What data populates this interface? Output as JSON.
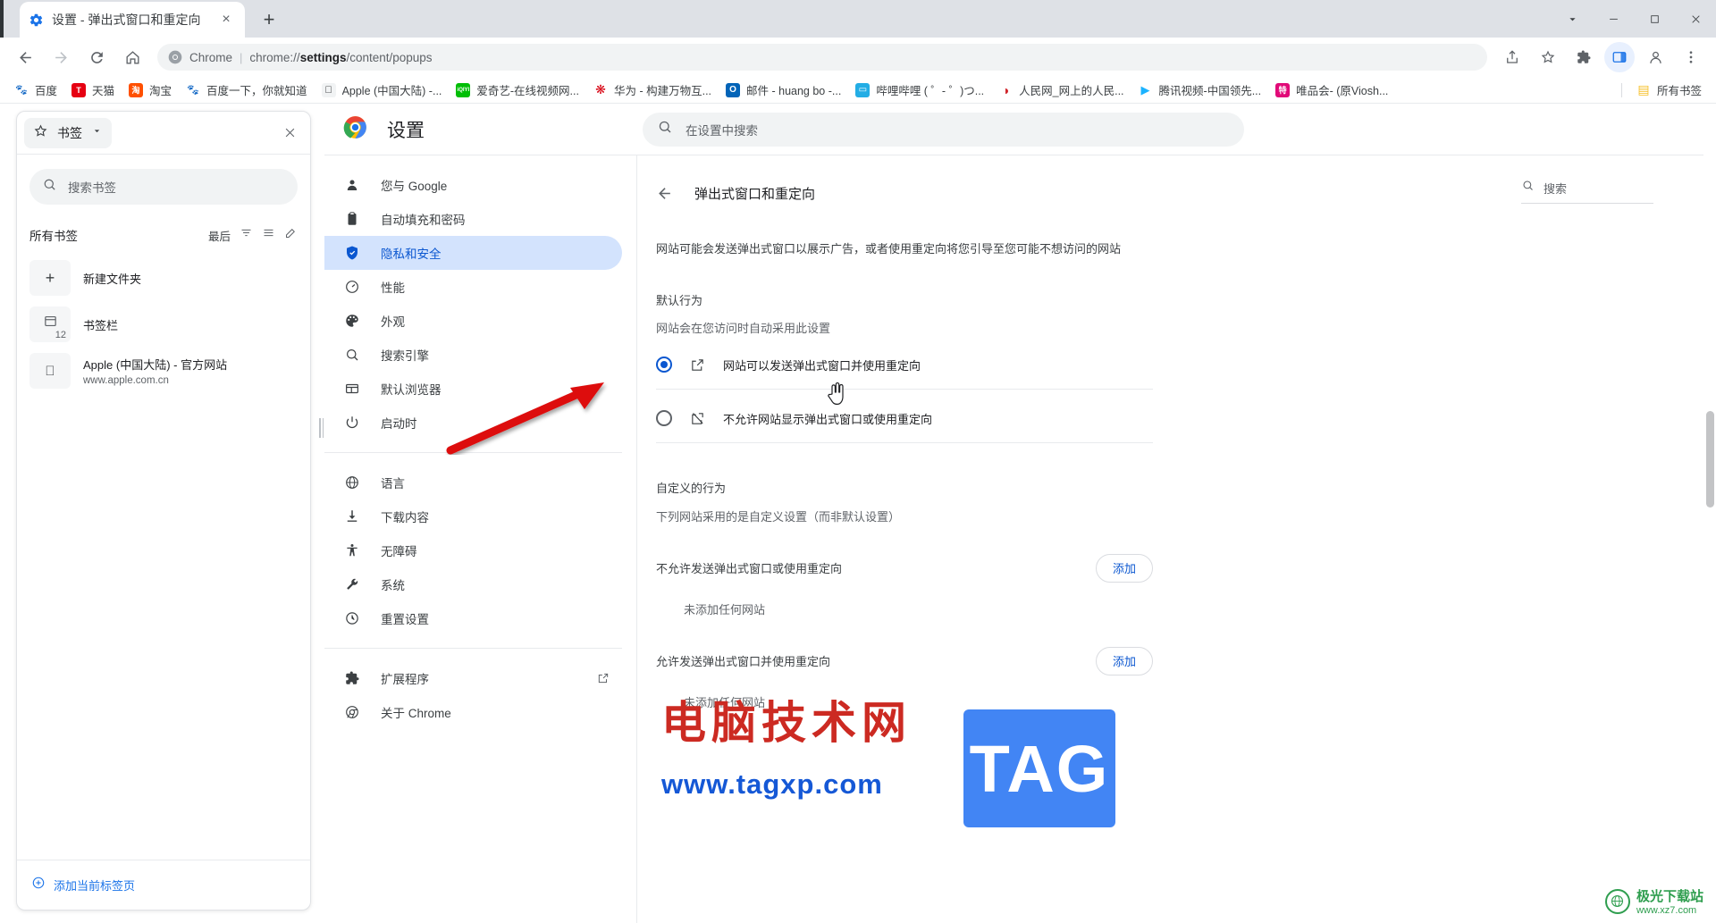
{
  "window": {
    "controls": {
      "expand": "chevron-down-icon",
      "minimize": "minimize-icon",
      "maximize": "maximize-icon",
      "close": "close-icon"
    }
  },
  "tabstrip": {
    "tabs": [
      {
        "title": "设置 - 弹出式窗口和重定向",
        "favicon": "settings-gear-icon",
        "close": "×"
      }
    ],
    "new_tab_label": "+"
  },
  "toolbar": {
    "back": "back-arrow-icon",
    "forward": "forward-arrow-icon",
    "reload": "reload-icon",
    "home": "home-icon",
    "omnibox": {
      "scheme_label": "Chrome",
      "separator": "|",
      "url_prefix": "chrome://",
      "url_bold": "settings",
      "url_suffix": "/content/popups"
    },
    "share": "share-icon",
    "bookmark_star": "star-icon",
    "extensions": "puzzle-icon",
    "side_panel": "side-panel-icon",
    "profile": "profile-icon",
    "menu": "three-dots-icon"
  },
  "bookmarks_bar": {
    "items": [
      {
        "label": "百度",
        "fav": "baidu",
        "color": "#2b58d1",
        "glyph": "熊"
      },
      {
        "label": "天猫",
        "fav": "tmall",
        "color": "#e60012",
        "glyph": "T"
      },
      {
        "label": "淘宝",
        "fav": "taobao",
        "color": "#ff5000",
        "glyph": "淘"
      },
      {
        "label": "百度一下，你就知道",
        "fav": "baidu",
        "color": "#2b58d1",
        "glyph": "熊"
      },
      {
        "label": "Apple (中国大陆) -...",
        "fav": "apple",
        "color": "#f2f2f2",
        "glyph": ""
      },
      {
        "label": "爱奇艺-在线视频网...",
        "fav": "iqiyi",
        "color": "#00be06",
        "glyph": "iQIYI"
      },
      {
        "label": "华为 - 构建万物互...",
        "fav": "huawei",
        "color": "#ffffff",
        "glyph": "❋"
      },
      {
        "label": "邮件 - huang bo -...",
        "fav": "outlook",
        "color": "#0364b8",
        "glyph": "O"
      },
      {
        "label": "哔哩哔哩 ( ゜- ゜)つ...",
        "fav": "bilibili",
        "color": "#23ade5",
        "glyph": "tv"
      },
      {
        "label": "人民网_网上的人民...",
        "fav": "people",
        "color": "#d0252b",
        "glyph": "◐"
      },
      {
        "label": "腾讯视频-中国领先...",
        "fav": "tencent-video",
        "color": "#1bb3ff",
        "glyph": "▶"
      },
      {
        "label": "唯品会- (原Viosh...",
        "fav": "vip",
        "color": "#e10a78",
        "glyph": "特"
      }
    ],
    "all_bookmarks_label": "所有书签",
    "all_bookmarks_icon": "folder-icon"
  },
  "side_panel": {
    "header": {
      "combo_label": "书签",
      "star_icon": "star-icon",
      "caret_icon": "chevron-down-icon",
      "close_icon": "close-icon"
    },
    "search": {
      "placeholder": "搜索书签",
      "icon": "search-icon"
    },
    "list_header": {
      "title": "所有书签",
      "sort_label": "最后",
      "sort_icon": "filter-icon",
      "view_icon": "list-view-icon",
      "edit_icon": "pencil-icon"
    },
    "rows": [
      {
        "thumb": "plus-icon",
        "count": "",
        "title": "新建文件夹",
        "subtitle": ""
      },
      {
        "thumb": "folder-icon",
        "count": "12",
        "title": "书签栏",
        "subtitle": ""
      },
      {
        "thumb": "apple-icon",
        "count": "",
        "title": "Apple (中国大陆) - 官方网站",
        "subtitle": "www.apple.com.cn"
      }
    ],
    "footer": {
      "icon": "plus-circle-icon",
      "label": "添加当前标签页"
    }
  },
  "settings": {
    "brand": {
      "logo": "chrome-logo-icon",
      "title": "设置"
    },
    "top_search": {
      "icon": "search-icon",
      "placeholder": "在设置中搜索"
    },
    "nav": {
      "group1": [
        {
          "icon": "person-icon",
          "label": "您与 Google",
          "selected": false
        },
        {
          "icon": "clipboard-icon",
          "label": "自动填充和密码",
          "selected": false
        },
        {
          "icon": "shield-icon",
          "label": "隐私和安全",
          "selected": true
        },
        {
          "icon": "gauge-icon",
          "label": "性能",
          "selected": false
        },
        {
          "icon": "palette-icon",
          "label": "外观",
          "selected": false
        },
        {
          "icon": "search-icon",
          "label": "搜索引擎",
          "selected": false
        },
        {
          "icon": "browser-icon",
          "label": "默认浏览器",
          "selected": false
        },
        {
          "icon": "power-icon",
          "label": "启动时",
          "selected": false
        }
      ],
      "group2": [
        {
          "icon": "globe-icon",
          "label": "语言",
          "selected": false
        },
        {
          "icon": "download-icon",
          "label": "下载内容",
          "selected": false
        },
        {
          "icon": "accessibility-icon",
          "label": "无障碍",
          "selected": false
        },
        {
          "icon": "wrench-icon",
          "label": "系统",
          "selected": false
        },
        {
          "icon": "history-icon",
          "label": "重置设置",
          "selected": false
        }
      ],
      "group3": [
        {
          "icon": "extension-icon",
          "label": "扩展程序",
          "selected": false,
          "external": "external-link-icon"
        },
        {
          "icon": "chrome-circle-icon",
          "label": "关于 Chrome",
          "selected": false
        }
      ]
    },
    "main": {
      "back_icon": "back-arrow-icon",
      "page_title": "弹出式窗口和重定向",
      "search": {
        "icon": "search-icon",
        "placeholder": "搜索"
      },
      "description": "网站可能会发送弹出式窗口以展示广告，或者使用重定向将您引导至您可能不想访问的网站",
      "default_section": {
        "title": "默认行为",
        "subtitle": "网站会在您访问时自动采用此设置",
        "options": [
          {
            "icon": "popup-allow-icon",
            "label": "网站可以发送弹出式窗口并使用重定向",
            "selected": true
          },
          {
            "icon": "popup-block-icon",
            "label": "不允许网站显示弹出式窗口或使用重定向",
            "selected": false
          }
        ]
      },
      "custom_section": {
        "title": "自定义的行为",
        "subtitle": "下列网站采用的是自定义设置（而非默认设置）",
        "blocks": [
          {
            "label": "不允许发送弹出式窗口或使用重定向",
            "add_label": "添加",
            "empty_text": "未添加任何网站"
          },
          {
            "label": "允许发送弹出式窗口并使用重定向",
            "add_label": "添加",
            "empty_text": "未添加任何网站"
          }
        ]
      }
    }
  },
  "annotations": {
    "arrow": {
      "color": "#dd1111",
      "name": "red-pointer-arrow"
    },
    "cursor": {
      "name": "hand-pointer-cursor"
    }
  },
  "watermarks": {
    "main_cn": "电脑技术网",
    "main_url": "www.tagxp.com",
    "tag_badge": "TAG",
    "bottom_right_title": "极光下载站",
    "bottom_right_sub": "www.xz7.com",
    "colors": {
      "cn_red": "#cc2a22",
      "url_blue": "#1558d6",
      "badge_blue": "#4285f4",
      "green": "#2f9e4f"
    }
  }
}
